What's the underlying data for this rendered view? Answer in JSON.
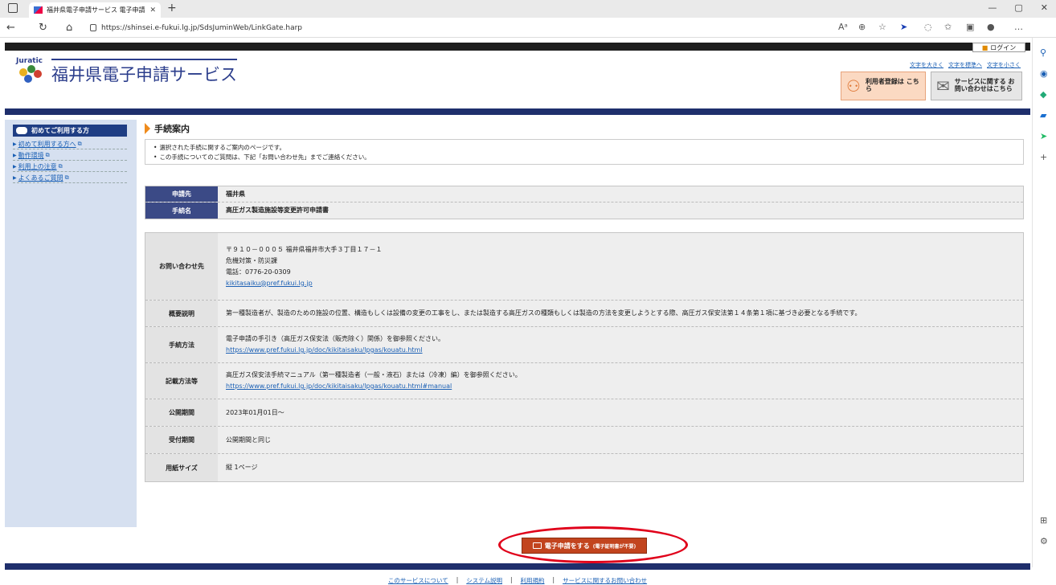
{
  "browser": {
    "tab_title": "福井県電子申請サービス 電子申請",
    "url": "https://shinsei.e-fukui.lg.jp/SdsJuminWeb/LinkGate.harp"
  },
  "site": {
    "login_label": "ログイン",
    "logo_small": "Juratic",
    "title": "福井県電子申請サービス",
    "fontsize_links": [
      "文字を大きく",
      "文字を標準へ",
      "文字を小さく"
    ],
    "register_button": "利用者登録は こちら",
    "contact_button": "サービスに関する お問い合わせはこちら"
  },
  "sidebar": {
    "heading": "初めてご利用する方",
    "items": [
      "初めて利用する方へ",
      "動作環境",
      "利用上の注意",
      "よくあるご質問"
    ]
  },
  "main": {
    "heading": "手続案内",
    "notes": [
      "選択された手続に関するご案内のページです。",
      "この手続についてのご質問は、下記「お問い合わせ先」までご連絡ください。"
    ],
    "basic": [
      {
        "label": "申請先",
        "value": "福井県"
      },
      {
        "label": "手続名",
        "value": "高圧ガス製造施設等変更許可申請書"
      }
    ],
    "contact": {
      "label": "お問い合わせ先",
      "address": "〒９１０－０００５ 福井県福井市大手３丁目１７－１",
      "dept": "危機対策・防災課",
      "phone": "電話：0776-20-0309",
      "email": "kikitasaiku@pref.fukui.lg.jp"
    },
    "summary": {
      "label": "概要説明",
      "value": "第一種製造者が、製造のための施設の位置、構造もしくは設備の変更の工事をし、または製造する高圧ガスの種類もしくは製造の方法を変更しようとする際、高圧ガス保安法第１４条第１項に基づき必要となる手続です。"
    },
    "method": {
      "label": "手続方法",
      "text": "電子申請の手引き（高圧ガス保安法（販売除く）関係）を御参照ください。",
      "link": "https://www.pref.fukui.lg.jp/doc/kikitaisaku/lpgas/kouatu.html"
    },
    "howto": {
      "label": "記載方法等",
      "text": "高圧ガス保安法手続マニュアル（第一種製造者（一般・液石）または（冷凍）編）を御参照ください。",
      "link": "https://www.pref.fukui.lg.jp/doc/kikitaisaku/lpgas/kouatu.html#manual"
    },
    "period": {
      "label": "公開期間",
      "value": "2023年01月01日～"
    },
    "accept": {
      "label": "受付期間",
      "value": "公開期間と同じ"
    },
    "paper": {
      "label": "用紙サイズ",
      "value": "縦 1ページ"
    },
    "submit_label": "電子申請をする",
    "submit_sub": "(電子証明書が不要)"
  },
  "footer": {
    "links": [
      "このサービスについて",
      "システム説明",
      "利用規約",
      "サービスに関するお問い合わせ"
    ]
  }
}
